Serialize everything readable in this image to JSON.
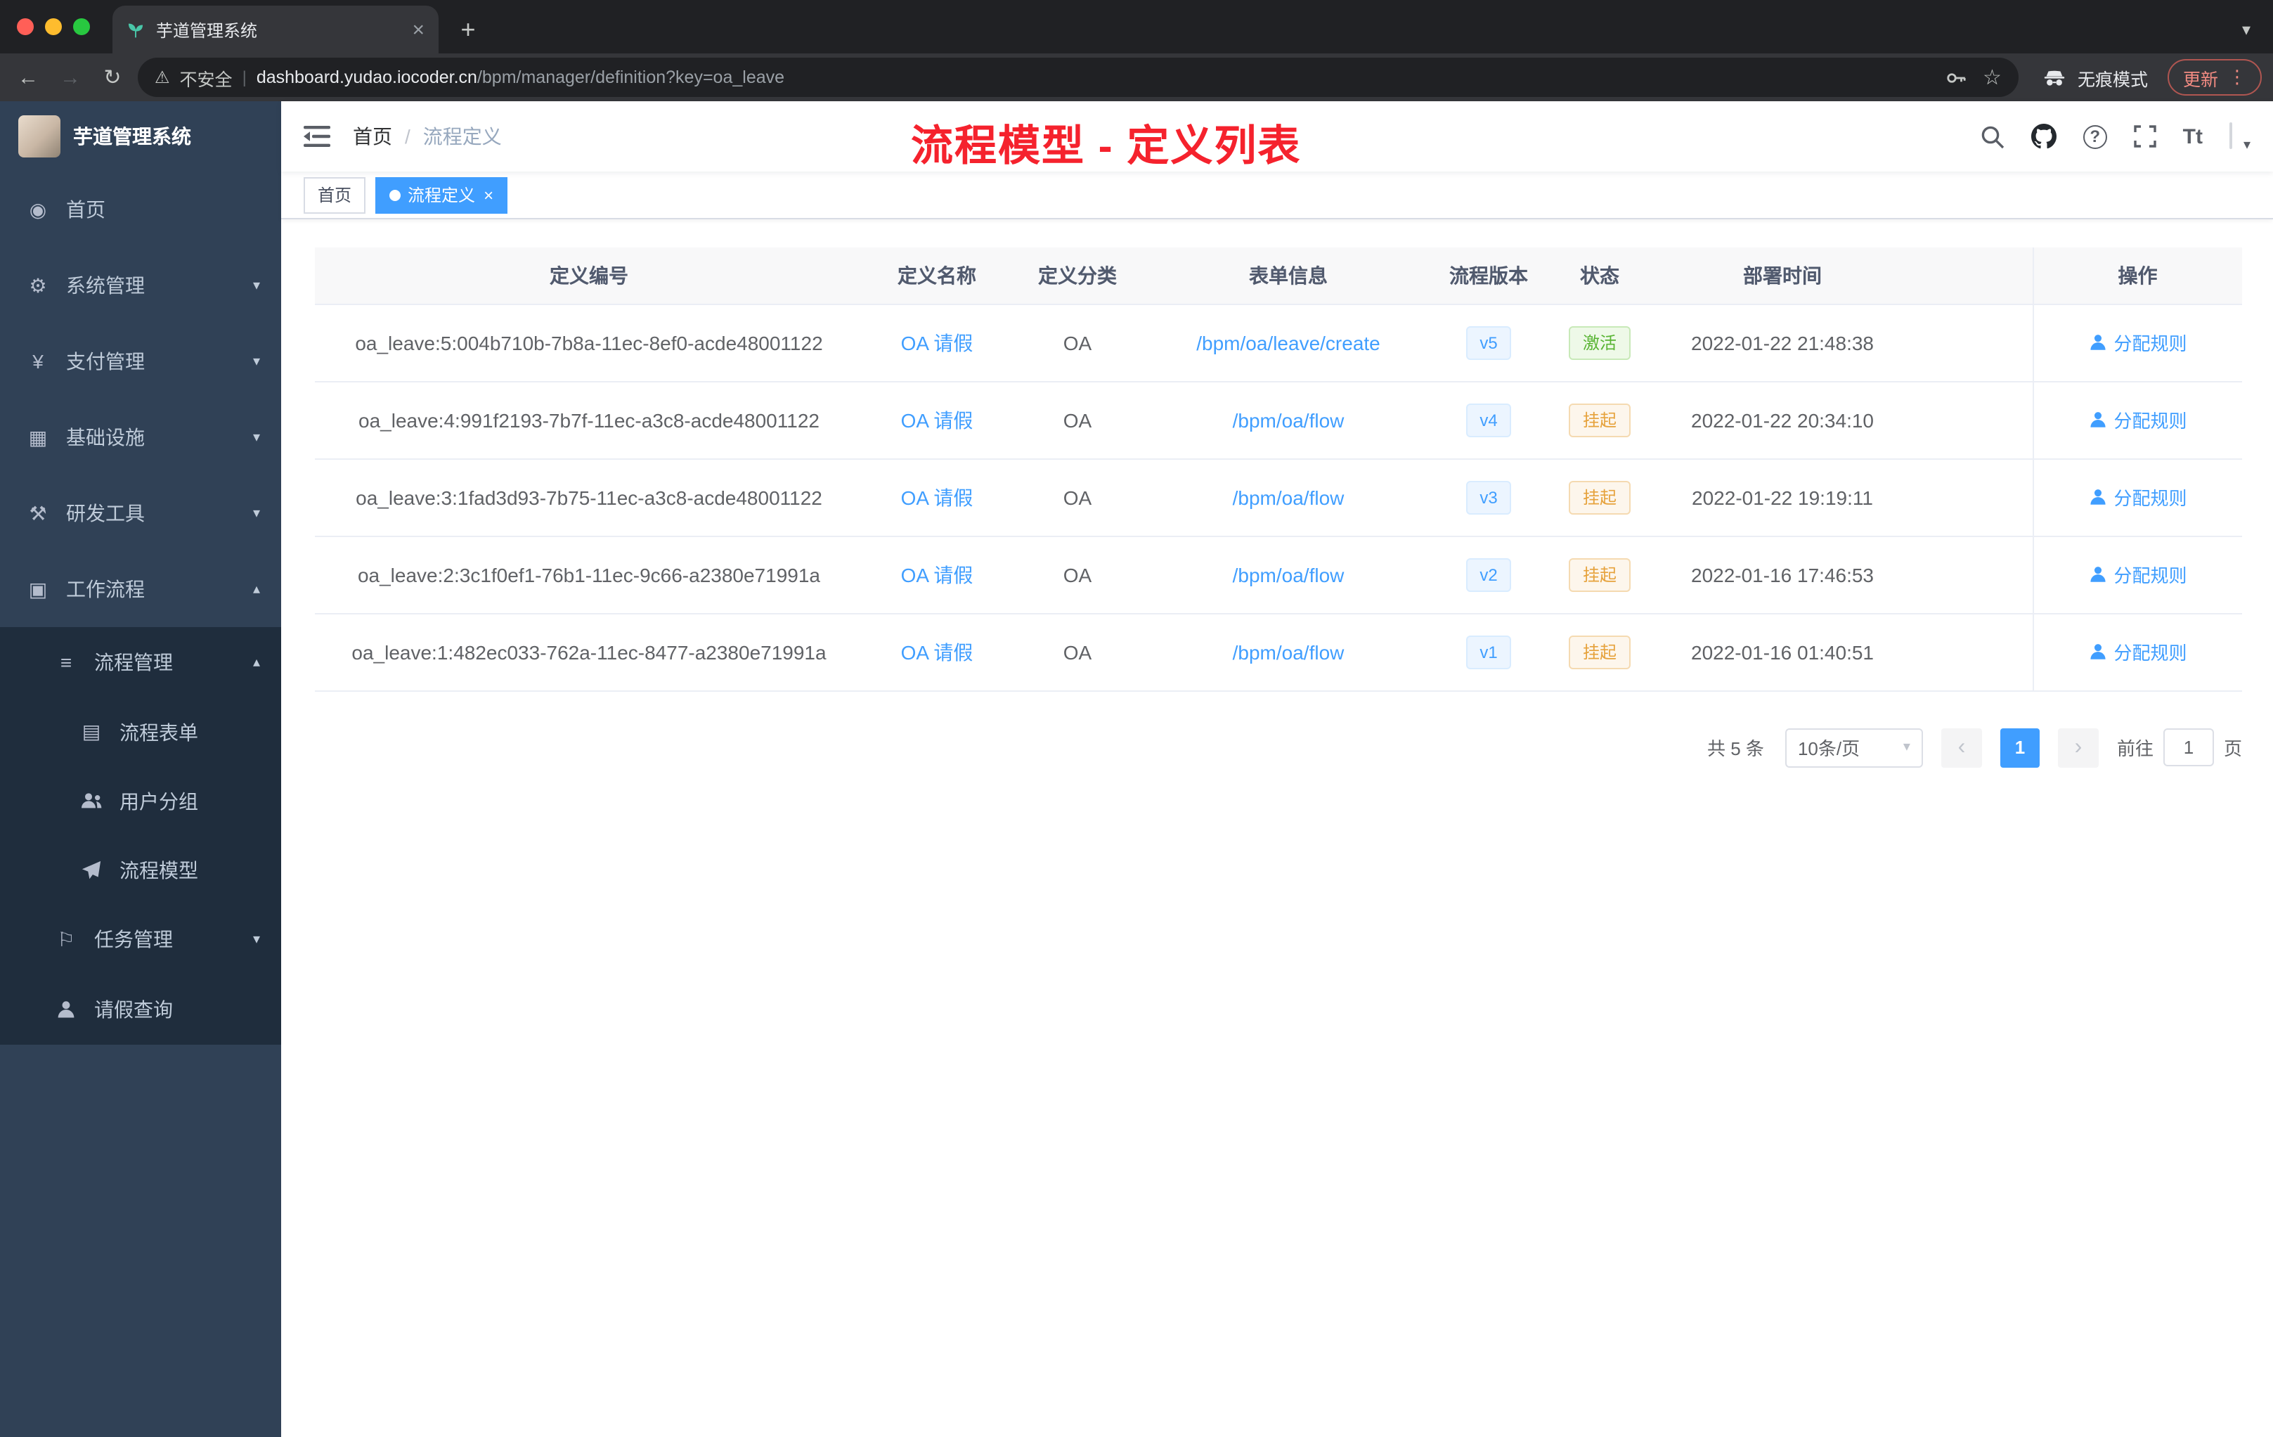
{
  "colors": {
    "accent": "#409eff",
    "success": "#58b433",
    "warning": "#e6a23c",
    "annotation_red": "#f5222d",
    "sidebar_bg": "#304156",
    "submenu_bg": "#1f2d3d",
    "browser_dark": "#202124",
    "browser_toolbar": "#35363a",
    "update_chip": "#f28b82"
  },
  "icons": {
    "chevron_down": "▾",
    "chevron_up": "▴",
    "close": "×",
    "plus": "+",
    "back": "←",
    "forward": "→",
    "reload": "↻",
    "warning_triangle": "⚠",
    "star": "☆",
    "more_vertical": "⋮",
    "pipe": "|",
    "breadcrumb_sep": "/",
    "page_prev": "‹",
    "page_next": "›",
    "question": "?",
    "home": "◉",
    "gear": "⚙",
    "yen": "¥",
    "infra": "▦",
    "tools": "⚒",
    "workflow": "▣",
    "list": "≡",
    "form": "▤",
    "flag": "⚐",
    "dot": "●"
  },
  "browser": {
    "tab_title": "芋道管理系统",
    "security_label": "不安全",
    "url_domain": "dashboard.yudao.iocoder.cn",
    "url_path": "/bpm/manager/definition?key=oa_leave",
    "incognito_label": "无痕模式",
    "update_label": "更新"
  },
  "sidebar": {
    "logo_title": "芋道管理系统",
    "items": [
      {
        "label": "首页"
      },
      {
        "label": "系统管理"
      },
      {
        "label": "支付管理"
      },
      {
        "label": "基础设施"
      },
      {
        "label": "研发工具"
      },
      {
        "label": "工作流程"
      },
      {
        "label": "流程管理"
      },
      {
        "label": "流程表单"
      },
      {
        "label": "用户分组"
      },
      {
        "label": "流程模型"
      },
      {
        "label": "任务管理"
      },
      {
        "label": "请假查询"
      }
    ]
  },
  "navbar": {
    "breadcrumb_home": "首页",
    "breadcrumb_current": "流程定义",
    "annotation": "流程模型 - 定义列表",
    "font_icon": "Tt"
  },
  "tags": {
    "home": "首页",
    "current": "流程定义"
  },
  "table": {
    "headers": [
      "定义编号",
      "定义名称",
      "定义分类",
      "表单信息",
      "流程版本",
      "状态",
      "部署时间",
      "操作"
    ],
    "action_label": "分配规则",
    "rows": [
      {
        "id": "oa_leave:5:004b710b-7b8a-11ec-8ef0-acde48001122",
        "name": "OA 请假",
        "category": "OA",
        "form": "/bpm/oa/leave/create",
        "version": "v5",
        "status": "激活",
        "status_type": "success",
        "time": "2022-01-22 21:48:38"
      },
      {
        "id": "oa_leave:4:991f2193-7b7f-11ec-a3c8-acde48001122",
        "name": "OA 请假",
        "category": "OA",
        "form": "/bpm/oa/flow",
        "version": "v4",
        "status": "挂起",
        "status_type": "warning",
        "time": "2022-01-22 20:34:10"
      },
      {
        "id": "oa_leave:3:1fad3d93-7b75-11ec-a3c8-acde48001122",
        "name": "OA 请假",
        "category": "OA",
        "form": "/bpm/oa/flow",
        "version": "v3",
        "status": "挂起",
        "status_type": "warning",
        "time": "2022-01-22 19:19:11"
      },
      {
        "id": "oa_leave:2:3c1f0ef1-76b1-11ec-9c66-a2380e71991a",
        "name": "OA 请假",
        "category": "OA",
        "form": "/bpm/oa/flow",
        "version": "v2",
        "status": "挂起",
        "status_type": "warning",
        "time": "2022-01-16 17:46:53"
      },
      {
        "id": "oa_leave:1:482ec033-762a-11ec-8477-a2380e71991a",
        "name": "OA 请假",
        "category": "OA",
        "form": "/bpm/oa/flow",
        "version": "v1",
        "status": "挂起",
        "status_type": "warning",
        "time": "2022-01-16 01:40:51"
      }
    ]
  },
  "pagination": {
    "total": "共 5 条",
    "page_size": "10条/页",
    "current_page": "1",
    "goto_label": "前往",
    "goto_value": "1",
    "page_unit": "页"
  }
}
